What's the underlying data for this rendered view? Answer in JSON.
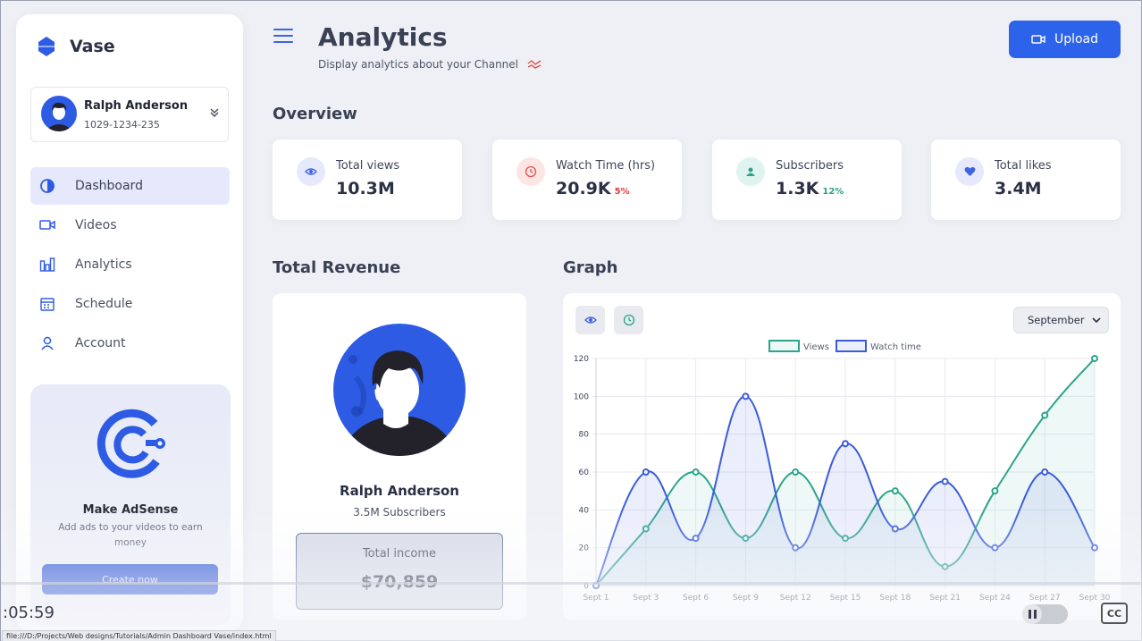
{
  "brand": {
    "name": "Vase"
  },
  "profile": {
    "name": "Ralph Anderson",
    "id": "1029-1234-235"
  },
  "nav": [
    {
      "label": "Dashboard",
      "icon": "half-circle-icon",
      "active": true
    },
    {
      "label": "Videos",
      "icon": "video-camera-icon"
    },
    {
      "label": "Analytics",
      "icon": "bar-chart-icon"
    },
    {
      "label": "Schedule",
      "icon": "calendar-icon"
    },
    {
      "label": "Account",
      "icon": "user-icon"
    }
  ],
  "promo": {
    "title": "Make AdSense",
    "desc": "Add ads to your videos to earn money",
    "button": "Create now"
  },
  "header": {
    "title": "Analytics",
    "subtitle": "Display analytics about your Channel",
    "upload": "Upload"
  },
  "overview": {
    "heading": "Overview",
    "cards": [
      {
        "label": "Total views",
        "value": "10.3M",
        "delta": "",
        "icon": "eye-icon",
        "color": "#3d63e0",
        "bg": "#e5e9fb"
      },
      {
        "label": "Watch Time (hrs)",
        "value": "20.9K",
        "delta": "5%",
        "delta_color": "#e23a3a",
        "icon": "clock-icon",
        "color": "#e0524a",
        "bg": "#fde5e3"
      },
      {
        "label": "Subscribers",
        "value": "1.3K",
        "delta": "12%",
        "delta_color": "#2ba58a",
        "icon": "users-icon",
        "color": "#2ba58a",
        "bg": "#e0f4ef"
      },
      {
        "label": "Total likes",
        "value": "3.4M",
        "delta": "",
        "icon": "heart-icon",
        "color": "#3d63e0",
        "bg": "#e5e9fb"
      }
    ]
  },
  "revenue": {
    "heading": "Total Revenue",
    "name": "Ralph Anderson",
    "subscribers": "3.5M Subscribers",
    "income_label": "Total income",
    "income_value": "$70,859"
  },
  "graph": {
    "heading": "Graph",
    "month": "September"
  },
  "chart_data": {
    "type": "line",
    "x": [
      "Sept 1",
      "Sept 3",
      "Sept 6",
      "Sept 9",
      "Sept 12",
      "Sept 15",
      "Sept 18",
      "Sept 21",
      "Sept 24",
      "Sept 27",
      "Sept 30"
    ],
    "series": [
      {
        "name": "Views",
        "color": "#2ba58a",
        "values": [
          0,
          30,
          60,
          25,
          60,
          25,
          50,
          10,
          50,
          90,
          120
        ]
      },
      {
        "name": "Watch time",
        "color": "#3b5bdb",
        "values": [
          0,
          60,
          25,
          100,
          20,
          75,
          30,
          55,
          20,
          60,
          20
        ]
      }
    ],
    "ylim": [
      0,
      120
    ],
    "yticks": [
      0,
      20,
      40,
      60,
      80,
      100,
      120
    ],
    "grid": true,
    "legend": "top-center"
  },
  "player": {
    "time": ":05:59",
    "cc": "CC"
  },
  "status_bar": {
    "url": "file:///D:/Projects/Web designs/Tutorials/Admin Dashboard Vase/index.html"
  }
}
